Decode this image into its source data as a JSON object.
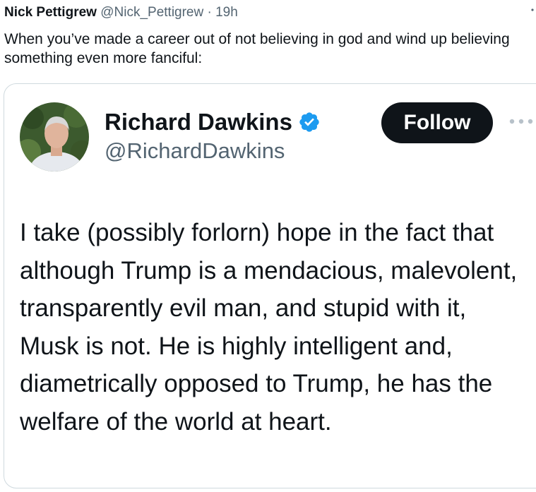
{
  "outer_tweet": {
    "author_name": "Nick Pettigrew",
    "author_handle": "@Nick_Pettigrew",
    "separator": "·",
    "time": "19h",
    "text": "When you’ve made a career out of not believing in god and wind up believing something even more fanciful:",
    "more_icon": "more-vertical-icon"
  },
  "quoted_tweet": {
    "author_name": "Richard Dawkins",
    "author_handle": "@RichardDawkins",
    "verified_icon": "verified-badge-icon",
    "verified_color": "#1d9bf0",
    "follow_label": "Follow",
    "more_icon": "more-horizontal-icon",
    "text": "I take  (possibly forlorn) hope in the fact that although Trump is a mendacious, malevolent,  transparently evil man, and stupid with it, Musk is not. He is highly intelligent and, diametrically opposed to Trump, he has the welfare of the world at heart."
  },
  "colors": {
    "text_primary": "#0f1419",
    "text_secondary": "#536471",
    "border": "#cfd9de",
    "follow_bg": "#0f1419",
    "follow_text": "#ffffff"
  }
}
